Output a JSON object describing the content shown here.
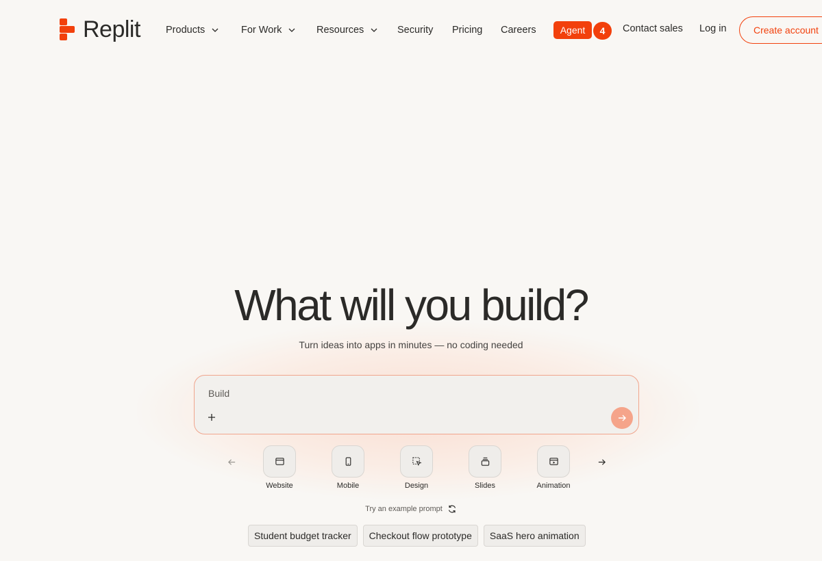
{
  "brand": {
    "name": "Replit",
    "accent": "#f2400c"
  },
  "nav": {
    "products": "Products",
    "for_work": "For Work",
    "resources": "Resources",
    "security": "Security",
    "pricing": "Pricing",
    "careers": "Careers",
    "agent": "Agent",
    "agent_count": "4",
    "contact_sales": "Contact sales",
    "log_in": "Log in",
    "create_account": "Create account"
  },
  "hero": {
    "headline": "What will you build?",
    "subhead": "Turn ideas into apps in minutes — no coding needed"
  },
  "prompt": {
    "placeholder": "Build"
  },
  "app_types": [
    {
      "label": "Website",
      "icon": "browser-window-icon"
    },
    {
      "label": "Mobile",
      "icon": "phone-icon"
    },
    {
      "label": "Design",
      "icon": "select-cursor-icon"
    },
    {
      "label": "Slides",
      "icon": "slides-stack-icon"
    },
    {
      "label": "Animation",
      "icon": "video-play-icon"
    }
  ],
  "examples": {
    "label": "Try an example prompt",
    "chips": [
      "Student budget tracker",
      "Checkout flow prototype",
      "SaaS hero animation"
    ]
  }
}
